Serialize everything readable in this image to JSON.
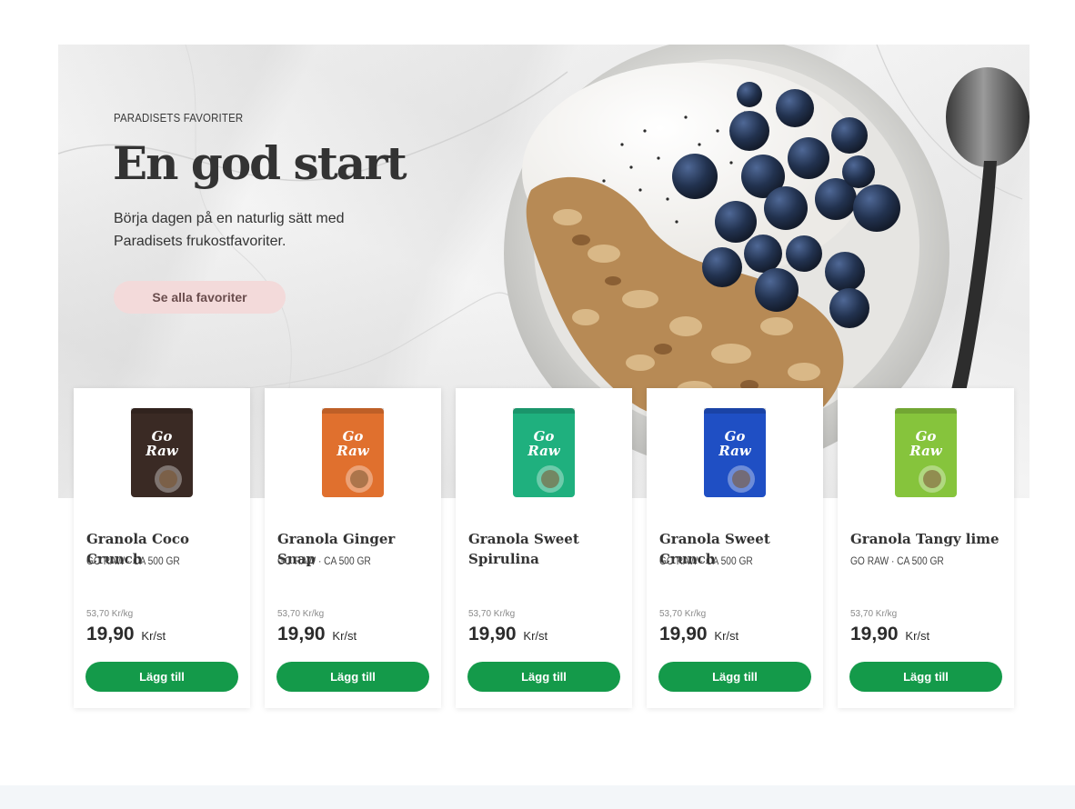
{
  "hero": {
    "eyebrow": "PARADISETS FAVORITER",
    "title": "En god start",
    "description": "Börja dagen på en naturlig sätt med Paradisets frukostfavoriter.",
    "button_label": "Se alla favoriter"
  },
  "products": [
    {
      "name": "Granola Coco Crunch",
      "brand": "GO RAW · CA 500 GR",
      "price_per_kg": "53,70 Kr/kg",
      "price": "19,90",
      "unit": "Kr/st",
      "add_label": "Lägg till",
      "pack_color": "#3a2a24",
      "pack_icon": "go-raw-coco-crunch-pack"
    },
    {
      "name": "Granola Ginger Snap",
      "brand": "GO RAW · CA 500 GR",
      "price_per_kg": "53,70 Kr/kg",
      "price": "19,90",
      "unit": "Kr/st",
      "add_label": "Lägg till",
      "pack_color": "#e0702e",
      "pack_icon": "go-raw-ginger-snap-pack"
    },
    {
      "name": "Granola Sweet Spirulina",
      "brand": "",
      "price_per_kg": "53,70 Kr/kg",
      "price": "19,90",
      "unit": "Kr/st",
      "add_label": "Lägg till",
      "pack_color": "#1fb07e",
      "pack_icon": "go-raw-sweet-spirulina-pack"
    },
    {
      "name": "Granola Sweet Crunch",
      "brand": "GO RAW · CA 500 GR",
      "price_per_kg": "53,70 Kr/kg",
      "price": "19,90",
      "unit": "Kr/st",
      "add_label": "Lägg till",
      "pack_color": "#1f4fc4",
      "pack_icon": "go-raw-sweet-crunch-pack"
    },
    {
      "name": "Granola Tangy lime",
      "brand": "GO RAW · CA 500 GR",
      "price_per_kg": "53,70 Kr/kg",
      "price": "19,90",
      "unit": "Kr/st",
      "add_label": "Lägg till",
      "pack_color": "#86c43c",
      "pack_icon": "go-raw-tangy-lime-pack"
    }
  ],
  "colors": {
    "accent_green": "#149a4a",
    "hero_button_bg": "#f3dada",
    "footer_band": "#f3f6f9"
  }
}
